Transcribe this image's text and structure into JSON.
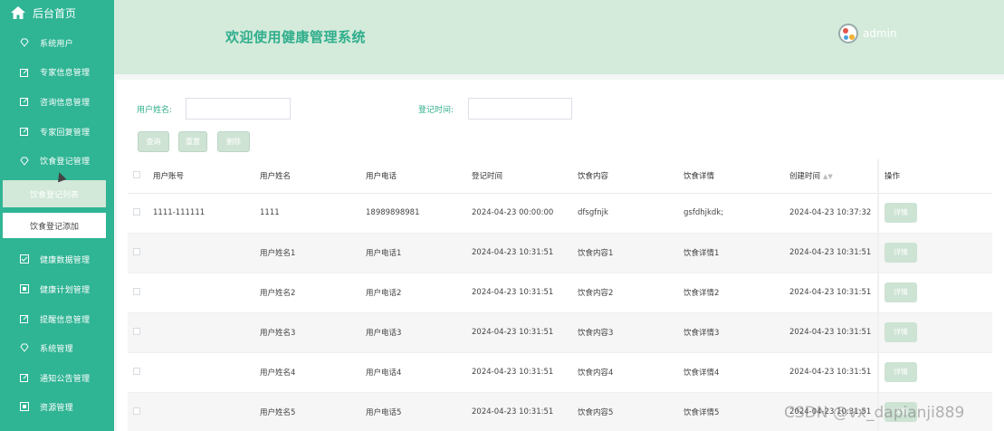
{
  "sidebar": {
    "home": "后台首页",
    "items": [
      {
        "label": "系统用户",
        "icon": "diamond-icon"
      },
      {
        "label": "专家信息管理",
        "icon": "edit-icon"
      },
      {
        "label": "咨询信息管理",
        "icon": "edit-icon"
      },
      {
        "label": "专家回复管理",
        "icon": "edit-icon"
      },
      {
        "label": "饮食登记管理",
        "icon": "diamond-icon"
      }
    ],
    "subs": [
      "饮食登记列表",
      "饮食登记添加"
    ],
    "lower": [
      {
        "label": "健康数据管理",
        "icon": "check-icon"
      },
      {
        "label": "健康计划管理",
        "icon": "doc-icon"
      },
      {
        "label": "提醒信息管理",
        "icon": "edit-icon"
      },
      {
        "label": "系统管理",
        "icon": "diamond-icon"
      },
      {
        "label": "通知公告管理",
        "icon": "edit-icon"
      },
      {
        "label": "资源管理",
        "icon": "doc-icon"
      }
    ]
  },
  "header": {
    "title": "欢迎使用健康管理系统",
    "user": "admin"
  },
  "search": {
    "name_label": "用户姓名:",
    "time_label": "登记时间:"
  },
  "buttons": {
    "query": "查询",
    "reset": "重置",
    "delete": "删除"
  },
  "table": {
    "columns": [
      "用户账号",
      "用户姓名",
      "用户电话",
      "登记时间",
      "饮食内容",
      "饮食详情",
      "创建时间",
      "操作"
    ],
    "detail_label": "详情",
    "rows": [
      [
        "1111-111111",
        "1111",
        "18989898981",
        "2024-04-23 00:00:00",
        "dfsgfnjk",
        "gsfdhjkdk;",
        "2024-04-23 10:37:32"
      ],
      [
        "",
        "用户姓名1",
        "用户电话1",
        "2024-04-23 10:31:51",
        "饮食内容1",
        "饮食详情1",
        "2024-04-23 10:31:51"
      ],
      [
        "",
        "用户姓名2",
        "用户电话2",
        "2024-04-23 10:31:51",
        "饮食内容2",
        "饮食详情2",
        "2024-04-23 10:31:51"
      ],
      [
        "",
        "用户姓名3",
        "用户电话3",
        "2024-04-23 10:31:51",
        "饮食内容3",
        "饮食详情3",
        "2024-04-23 10:31:51"
      ],
      [
        "",
        "用户姓名4",
        "用户电话4",
        "2024-04-23 10:31:51",
        "饮食内容4",
        "饮食详情4",
        "2024-04-23 10:31:51"
      ],
      [
        "",
        "用户姓名5",
        "用户电话5",
        "2024-04-23 10:31:51",
        "饮食内容5",
        "饮食详情5",
        "2024-04-23 10:31:51"
      ]
    ]
  },
  "watermark": "CSDN @vx_dapianji889",
  "colors": {
    "sidebar": "#2fb494",
    "header": "#d4ebdb",
    "accent": "#2fae8c"
  }
}
